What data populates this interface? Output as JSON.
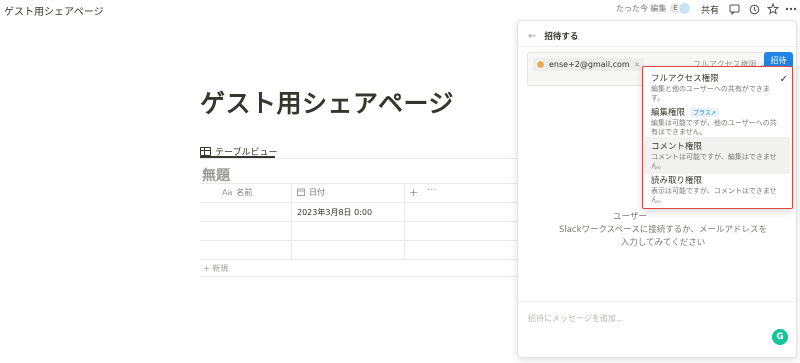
{
  "header": {
    "breadcrumb": "ゲスト用シェアページ",
    "edited": "たった今 編集",
    "avatar_initial": "E",
    "share_label": "共有",
    "icons": [
      "comment-icon",
      "history-icon",
      "star-icon",
      "more-icon"
    ]
  },
  "page": {
    "title": "ゲスト用シェアページ",
    "view_tab": "テーブルビュー",
    "database_title": "無題",
    "columns": {
      "name": {
        "icon": "Aa",
        "label": "名前"
      },
      "date": {
        "icon": "calendar-icon",
        "label": "日付"
      }
    },
    "rows": [
      {
        "name": "",
        "date": "2023年3月8日 0:00"
      },
      {
        "name": "",
        "date": ""
      },
      {
        "name": "",
        "date": ""
      }
    ],
    "new_row": "新規"
  },
  "invite_panel": {
    "title": "招待する",
    "chip_email": "ense+2@gmail.com",
    "permission_select": "フルアクセス権限",
    "invite_button": "招待",
    "hint_title": "ユーザー",
    "hint_line1": "Slackワークスペースに接続するか、メールアドレスを",
    "hint_line2": "入力してみてください",
    "message_placeholder": "招待にメッセージを追加...",
    "grammarly_label": "G"
  },
  "permission_menu": {
    "options": [
      {
        "title": "フルアクセス権限",
        "desc": "編集と他のユーザーへの共有ができます。",
        "selected": true,
        "badge": ""
      },
      {
        "title": "編集権限",
        "desc": "編集は可能ですが、他のユーザーへの共有はできません。",
        "selected": false,
        "badge": "プラス↗"
      },
      {
        "title": "コメント権限",
        "desc": "コメントは可能ですが、編集はできません。",
        "selected": false,
        "badge": ""
      },
      {
        "title": "読み取り権限",
        "desc": "表示は可能ですが、コメントはできません。",
        "selected": false,
        "badge": ""
      }
    ]
  },
  "colors": {
    "accent": "#2383e2",
    "highlight_border": "#e0443a",
    "text": "#37352f",
    "muted": "#787774"
  }
}
